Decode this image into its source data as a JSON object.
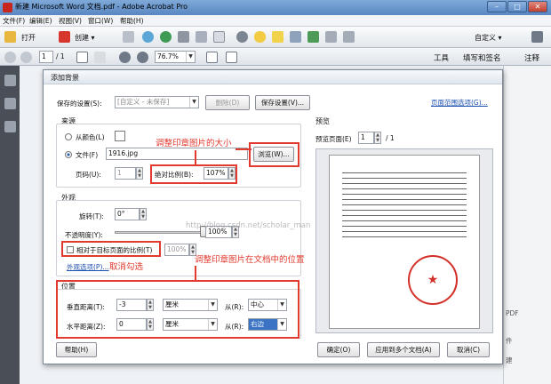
{
  "window": {
    "title": "新建 Microsoft Word 文档.pdf - Adobe Acrobat Pro",
    "minimize": "–",
    "maximize": "□",
    "close": "✕"
  },
  "menu": [
    "文件(F)",
    "编辑(E)",
    "视图(V)",
    "窗口(W)",
    "帮助(H)"
  ],
  "toolbar": {
    "open": "打开",
    "create": "创建 ▾",
    "customize": "自定义 ▾"
  },
  "navbar": {
    "page_current": "1",
    "page_total": "/ 1",
    "zoom": "76.7%",
    "tabs": [
      "工具",
      "填写和签名",
      "注释"
    ]
  },
  "dialog": {
    "title": "添加背景",
    "saved_settings_label": "保存的设置(S):",
    "saved_settings_value": "[自定义 - 未保存]",
    "delete_btn": "删除(D)",
    "save_settings_btn": "保存设置(V)...",
    "page_range_link": "页面范围选项(G)...",
    "source": {
      "heading": "来源",
      "from_color": "从颜色(L)",
      "file_label": "文件(F)",
      "file_value": "1916.jpg",
      "browse_btn": "浏览(W)...",
      "page_label": "页码(U):",
      "page_value": "1",
      "abs_scale_label": "绝对比例(B):",
      "abs_scale_value": "107%"
    },
    "appearance": {
      "heading": "外观",
      "rotation_label": "旋转(T):",
      "rotation_value": "0°",
      "opacity_label": "不透明度(Y):",
      "opacity_value": "100%",
      "relative_label": "相对于目标页面的比例(T)",
      "relative_value": "100%",
      "options_link": "外观选项(P)..."
    },
    "position": {
      "heading": "位置",
      "vertical_label": "垂直距离(T):",
      "vertical_value": "-3",
      "horizontal_label": "水平距离(Z):",
      "horizontal_value": "0",
      "unit": "厘米",
      "from_label": "从(R):",
      "vertical_from": "中心",
      "horizontal_from": "右边"
    },
    "preview": {
      "heading": "预览",
      "page_label": "预览页面(E)",
      "page_value": "1",
      "page_total": "/ 1"
    },
    "buttons": {
      "help": "帮助(H)",
      "ok": "确定(O)",
      "apply_multiple": "应用到多个文档(A)",
      "cancel": "取消(C)"
    }
  },
  "annotations": {
    "resize_stamp": "调整印章图片的大小",
    "uncheck": "取消勾选",
    "adjust_position": "调整印章图片在文档中的位置"
  },
  "watermark": "http://blog.csdn.net/scholar_man",
  "side_panel": {
    "item1": "PDF",
    "item2": "件",
    "item3": "建"
  },
  "colors": {
    "annotation_red": "#e23a2e",
    "link_blue": "#1a4fb0",
    "titlebar_blue": "#5a87c2"
  }
}
